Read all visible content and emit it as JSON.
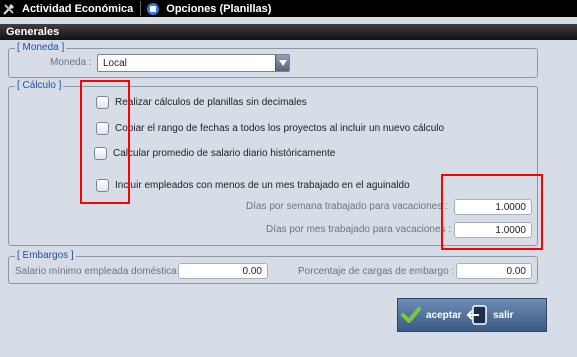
{
  "topbar": {
    "tabs": [
      {
        "label": "Actividad Económica",
        "icon": "tools-icon"
      },
      {
        "label": "Opciones (Planillas)",
        "icon": "options-icon"
      }
    ]
  },
  "section": {
    "title": "Generales"
  },
  "moneda": {
    "legend": "[ Moneda ]",
    "label": "Moneda :",
    "selected": "Local"
  },
  "calculo": {
    "legend": "[ Cálculo ]",
    "options": [
      {
        "label": "Realizar cálculos de planillas sin decimales"
      },
      {
        "label": "Copiar el rango de fechas a todos los proyectos al incluir un nuevo cálculo"
      },
      {
        "label": "Calcular promedio de salario diario históricamente"
      },
      {
        "label": "Incluir empleados con menos de un mes trabajado en el aguinaldo"
      }
    ],
    "dias_semana": {
      "label": "Días por semana trabajado para vacaciones :",
      "value": "1.0000"
    },
    "dias_mes": {
      "label": "Días por mes trabajado para vacaciones :",
      "value": "1.0000"
    }
  },
  "embargos": {
    "legend": "[ Embargos ]",
    "salario": {
      "label": "Salario mínimo empleada doméstica",
      "value": "0.00"
    },
    "porcentaje": {
      "label": "Porcentaje de cargas de embargo :",
      "value": "0.00"
    }
  },
  "actions": {
    "accept_label": "aceptar",
    "exit_label": "salir"
  },
  "colors": {
    "highlight": "#ff0000",
    "legend": "#1d4fb0",
    "accept_check": "#7ac943"
  }
}
